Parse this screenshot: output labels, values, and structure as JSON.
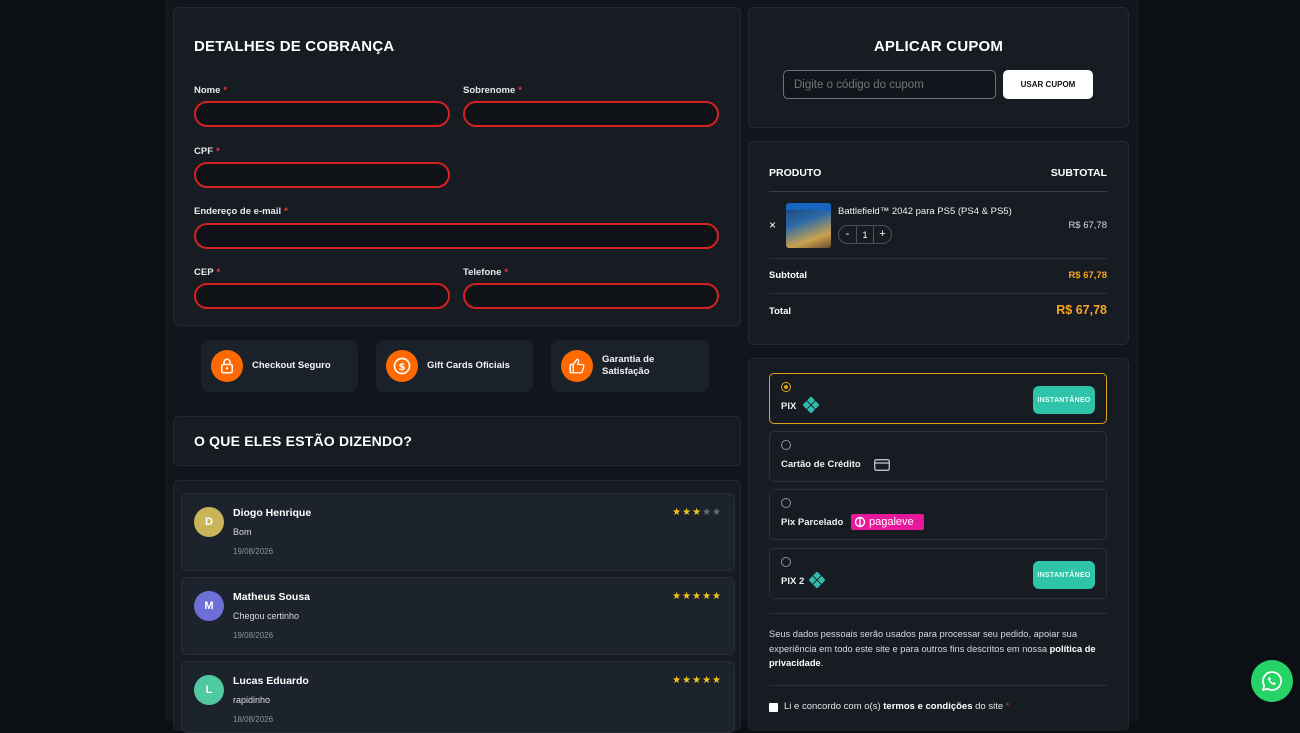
{
  "billing": {
    "title": "DETALHES DE COBRANÇA",
    "required_mark": "*",
    "fields": {
      "nome": "Nome",
      "sobrenome": "Sobrenome",
      "cpf": "CPF",
      "email": "Endereço de e-mail",
      "cep": "CEP",
      "telefone": "Telefone"
    }
  },
  "trust": [
    {
      "label": "Checkout Seguro",
      "icon": "lock-icon"
    },
    {
      "label": "Gift Cards Oficiais",
      "icon": "dollar-coin-icon"
    },
    {
      "label_line1": "Garantia de",
      "label_line2": "Satisfação",
      "icon": "thumbs-up-icon"
    }
  ],
  "reviews": {
    "title": "O QUE ELES ESTÃO DIZENDO?",
    "items": [
      {
        "initial": "D",
        "name": "Diogo Henrique",
        "text": "Bom",
        "date": "19/08/2026",
        "stars": 3,
        "avatar_color": "#c9b45a"
      },
      {
        "initial": "M",
        "name": "Matheus Sousa",
        "text": "Chegou certinho",
        "date": "19/08/2026",
        "stars": 5,
        "avatar_color": "#6f6fd8"
      },
      {
        "initial": "L",
        "name": "Lucas Eduardo",
        "text": "rapidinho",
        "date": "18/08/2026",
        "stars": 5,
        "avatar_color": "#4fc9a0"
      }
    ]
  },
  "coupon": {
    "title": "APLICAR CUPOM",
    "placeholder": "Digite o código do cupom",
    "button": "USAR CUPOM"
  },
  "order": {
    "col_product": "PRODUTO",
    "col_subtotal": "SUBTOTAL",
    "remove": "×",
    "product_name": "Battlefield™ 2042 para PS5 (PS4 & PS5)",
    "qty": "1",
    "minus": "-",
    "plus": "+",
    "line_total": "R$ 67,78",
    "subtotal_label": "Subtotal",
    "subtotal_value": "R$ 67,78",
    "total_label": "Total",
    "total_value": "R$ 67,78"
  },
  "payment": {
    "methods": [
      {
        "label": "PIX",
        "badge": "INSTANTÂNEO",
        "selected": true
      },
      {
        "label": "Cartão de Crédito"
      },
      {
        "label": "Pix Parcelado",
        "logo": "pagaleve"
      },
      {
        "label": "PIX 2",
        "badge": "INSTANTÂNEO"
      }
    ],
    "privacy_text": "Seus dados pessoais serão usados para processar seu pedido, apoiar sua experiência em todo este site e para outros fins descritos em nossa",
    "privacy_link": "política de privacidade",
    "privacy_end": ".",
    "terms_prefix": "Li e concordo com o(s)",
    "terms_link": "termos e condições",
    "terms_suffix": "do site",
    "terms_req": "*"
  },
  "colors": {
    "accent_orange": "#ff6a00",
    "error_red": "#d42121",
    "price_orange": "#f5a623",
    "instant_green": "#2ec4a8",
    "whatsapp": "#25d366"
  }
}
